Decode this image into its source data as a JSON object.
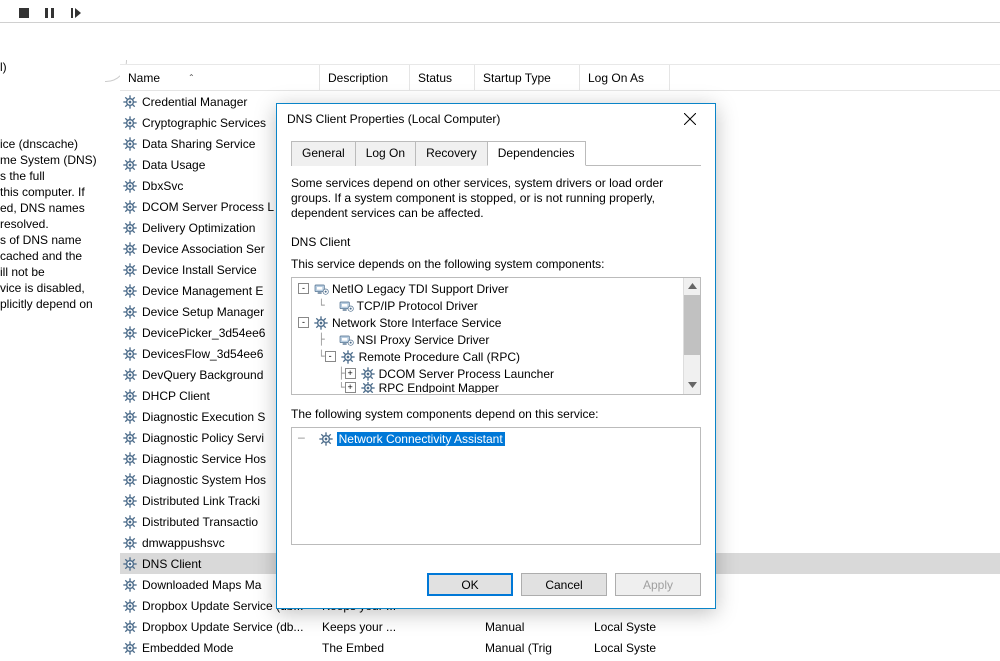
{
  "toolbar": {
    "stop_title": "Stop",
    "pause_title": "Pause",
    "start_title": "Start"
  },
  "left_panel": {
    "header_fragment": "l)",
    "lines": [
      "ice (dnscache)",
      "me System (DNS)",
      "s the full",
      "this computer. If",
      "ed, DNS names",
      "resolved.",
      "s of DNS name",
      "cached and the",
      "ill not be",
      "vice is disabled,",
      "plicitly depend on"
    ]
  },
  "columns": {
    "name": "Name",
    "description": "Description",
    "status": "Status",
    "startup": "Startup Type",
    "logon": "Log On As"
  },
  "services": [
    {
      "name": "Credential Manager",
      "selected": false
    },
    {
      "name": "Cryptographic Services",
      "selected": false
    },
    {
      "name": "Data Sharing Service",
      "selected": false
    },
    {
      "name": "Data Usage",
      "selected": false
    },
    {
      "name": "DbxSvc",
      "selected": false
    },
    {
      "name": "DCOM Server Process L",
      "selected": false
    },
    {
      "name": "Delivery Optimization",
      "selected": false
    },
    {
      "name": "Device Association Ser",
      "selected": false
    },
    {
      "name": "Device Install Service",
      "selected": false
    },
    {
      "name": "Device Management E",
      "selected": false
    },
    {
      "name": "Device Setup Manager",
      "selected": false
    },
    {
      "name": "DevicePicker_3d54ee6",
      "selected": false
    },
    {
      "name": "DevicesFlow_3d54ee6",
      "selected": false
    },
    {
      "name": "DevQuery Background",
      "selected": false
    },
    {
      "name": "DHCP Client",
      "selected": false
    },
    {
      "name": "Diagnostic Execution S",
      "selected": false
    },
    {
      "name": "Diagnostic Policy Servi",
      "selected": false
    },
    {
      "name": "Diagnostic Service Hos",
      "selected": false
    },
    {
      "name": "Diagnostic System Hos",
      "selected": false
    },
    {
      "name": "Distributed Link Tracki",
      "selected": false
    },
    {
      "name": "Distributed Transactio",
      "selected": false
    },
    {
      "name": "dmwappushsvc",
      "selected": false
    },
    {
      "name": "DNS Client",
      "selected": true
    },
    {
      "name": "Downloaded Maps Ma",
      "selected": false
    },
    {
      "name": "Dropbox Update Service (db...",
      "selected": false,
      "desc": "Keeps your ...",
      "startup": "",
      "logon": ""
    },
    {
      "name": "Dropbox Update Service (db...",
      "selected": false,
      "desc": "Keeps your ...",
      "startup": "Manual",
      "logon": "Local Syste"
    },
    {
      "name": "Embedded Mode",
      "selected": false,
      "desc": "The Embed",
      "startup": "Manual (Trig",
      "logon": "Local Syste"
    }
  ],
  "dialog": {
    "title": "DNS Client Properties (Local Computer)",
    "tabs": {
      "general": "General",
      "logon": "Log On",
      "recovery": "Recovery",
      "dependencies": "Dependencies"
    },
    "active_tab": "dependencies",
    "note": "Some services depend on other services, system drivers or load order groups. If a system component is stopped, or is not running properly, dependent services can be affected.",
    "service_name": "DNS Client",
    "depends_label": "This service depends on the following system components:",
    "dependents_label": "The following system components depend on this service:",
    "tree_depends": [
      {
        "indent": 0,
        "expander": "-",
        "icon": "driver",
        "label": "NetIO Legacy TDI Support Driver"
      },
      {
        "indent": 1,
        "expander": "",
        "icon": "driver",
        "label": "TCP/IP Protocol Driver",
        "conn": "└"
      },
      {
        "indent": 0,
        "expander": "-",
        "icon": "gear",
        "label": "Network Store Interface Service"
      },
      {
        "indent": 1,
        "expander": "",
        "icon": "driver",
        "label": "NSI Proxy Service Driver",
        "conn": "├"
      },
      {
        "indent": 1,
        "expander": "-",
        "icon": "gear",
        "label": "Remote Procedure Call (RPC)",
        "conn": "└"
      },
      {
        "indent": 2,
        "expander": "+",
        "icon": "gear",
        "label": "DCOM Server Process Launcher",
        "conn": "├"
      },
      {
        "indent": 2,
        "expander": "+",
        "icon": "gear",
        "label": "RPC Endpoint Mapper",
        "conn": "└",
        "cut": true
      }
    ],
    "tree_dependents": [
      {
        "indent": 0,
        "expander": "",
        "icon": "gear",
        "label": "Network Connectivity Assistant",
        "selected": true,
        "conn": "─"
      }
    ],
    "buttons": {
      "ok": "OK",
      "cancel": "Cancel",
      "apply": "Apply"
    }
  }
}
